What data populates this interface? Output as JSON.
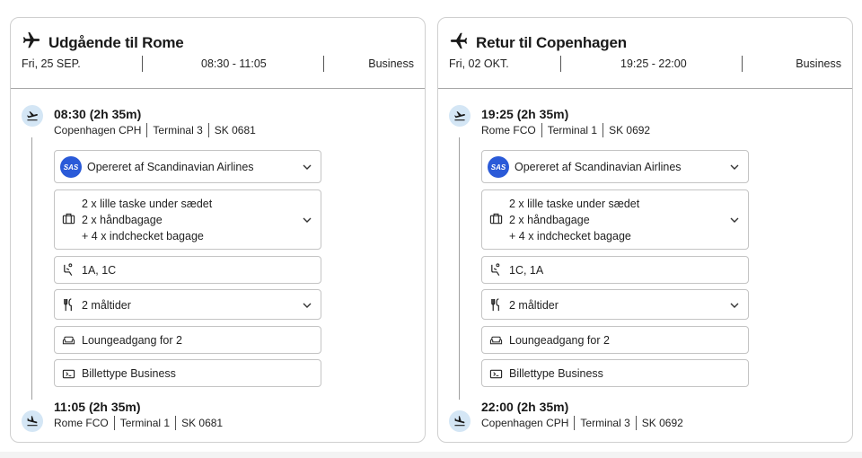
{
  "outbound": {
    "title": "Udgående til Rome",
    "date": "Fri, 25 SEP.",
    "time_range": "08:30 - 11:05",
    "cabin": "Business",
    "departure": {
      "time": "08:30",
      "duration": "(2h 35m)",
      "city": "Copenhagen",
      "code": "CPH",
      "terminal": "Terminal  3",
      "flight": "SK 0681"
    },
    "operator": "Opereret af Scandinavian Airlines",
    "baggage": [
      "2 x lille taske under sædet",
      "2 x håndbagage",
      "+ 4 x indchecket bagage"
    ],
    "seats": "1A, 1C",
    "meals": "2 måltider",
    "lounge": "Loungeadgang for 2",
    "ticket": "Billettype Business",
    "arrival": {
      "time": "11:05",
      "duration": "(2h 35m)",
      "city": "Rome",
      "code": "FCO",
      "terminal": "Terminal  1",
      "flight": "SK 0681"
    }
  },
  "return": {
    "title": "Retur til Copenhagen",
    "date": "Fri, 02 OKT.",
    "time_range": "19:25 - 22:00",
    "cabin": "Business",
    "departure": {
      "time": "19:25",
      "duration": "(2h 35m)",
      "city": "Rome",
      "code": "FCO",
      "terminal": "Terminal  1",
      "flight": "SK 0692"
    },
    "operator": "Opereret af Scandinavian Airlines",
    "baggage": [
      "2 x lille taske under sædet",
      "2 x håndbagage",
      "+ 4 x indchecket bagage"
    ],
    "seats": "1C, 1A",
    "meals": "2 måltider",
    "lounge": "Loungeadgang for 2",
    "ticket": "Billettype Business",
    "arrival": {
      "time": "22:00",
      "duration": "(2h 35m)",
      "city": "Copenhagen",
      "code": "CPH",
      "terminal": "Terminal  3",
      "flight": "SK 0692"
    }
  },
  "sas_logo_text": "SAS",
  "icons": [
    "airplane-icon",
    "takeoff-icon",
    "landing-icon",
    "sas-logo",
    "luggage-icon",
    "seat-icon",
    "cutlery-icon",
    "sofa-icon",
    "ticket-icon",
    "chevron-down-icon"
  ],
  "colors": {
    "timeline_circle": "#d4e6f5",
    "sas_blue": "#2a5ad8",
    "border": "#c4c4c4"
  }
}
